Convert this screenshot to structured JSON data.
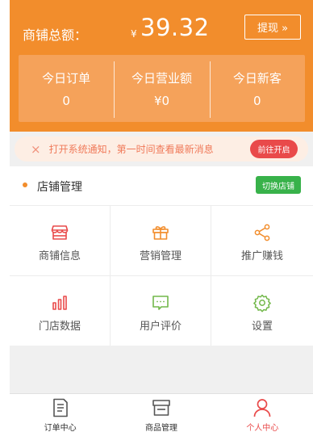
{
  "header": {
    "total_label": "商铺总额：",
    "currency": "¥",
    "total_amount": "39.32",
    "withdraw_label": "提现 »",
    "stats": [
      {
        "label": "今日订单",
        "value": "0"
      },
      {
        "label": "今日营业额",
        "value": "¥0"
      },
      {
        "label": "今日新客",
        "value": "0"
      }
    ]
  },
  "notice": {
    "close_glyph": "×",
    "text": "打开系统通知，第一时间查看最新消息",
    "button_label": "前往开启"
  },
  "store": {
    "title": "店铺管理",
    "switch_label": "切换店铺",
    "items": [
      {
        "label": "商铺信息",
        "icon": "store-icon"
      },
      {
        "label": "营销管理",
        "icon": "gift-icon"
      },
      {
        "label": "推广赚钱",
        "icon": "share-icon"
      },
      {
        "label": "门店数据",
        "icon": "bar-chart-icon"
      },
      {
        "label": "用户评价",
        "icon": "comment-icon"
      },
      {
        "label": "设置",
        "icon": "gear-icon"
      }
    ]
  },
  "tabbar": {
    "active_index": 2,
    "tabs": [
      {
        "label": "订单中心",
        "icon": "order-document-icon"
      },
      {
        "label": "商品管理",
        "icon": "goods-box-icon"
      },
      {
        "label": "个人中心",
        "icon": "user-icon"
      }
    ]
  },
  "colors": {
    "brand_orange": "#f28d2c",
    "accent_red": "#e94a4a",
    "accent_green": "#38b24a",
    "icon_red": "#e94a4a",
    "icon_orange": "#f28d2c",
    "icon_green": "#72b84a"
  }
}
